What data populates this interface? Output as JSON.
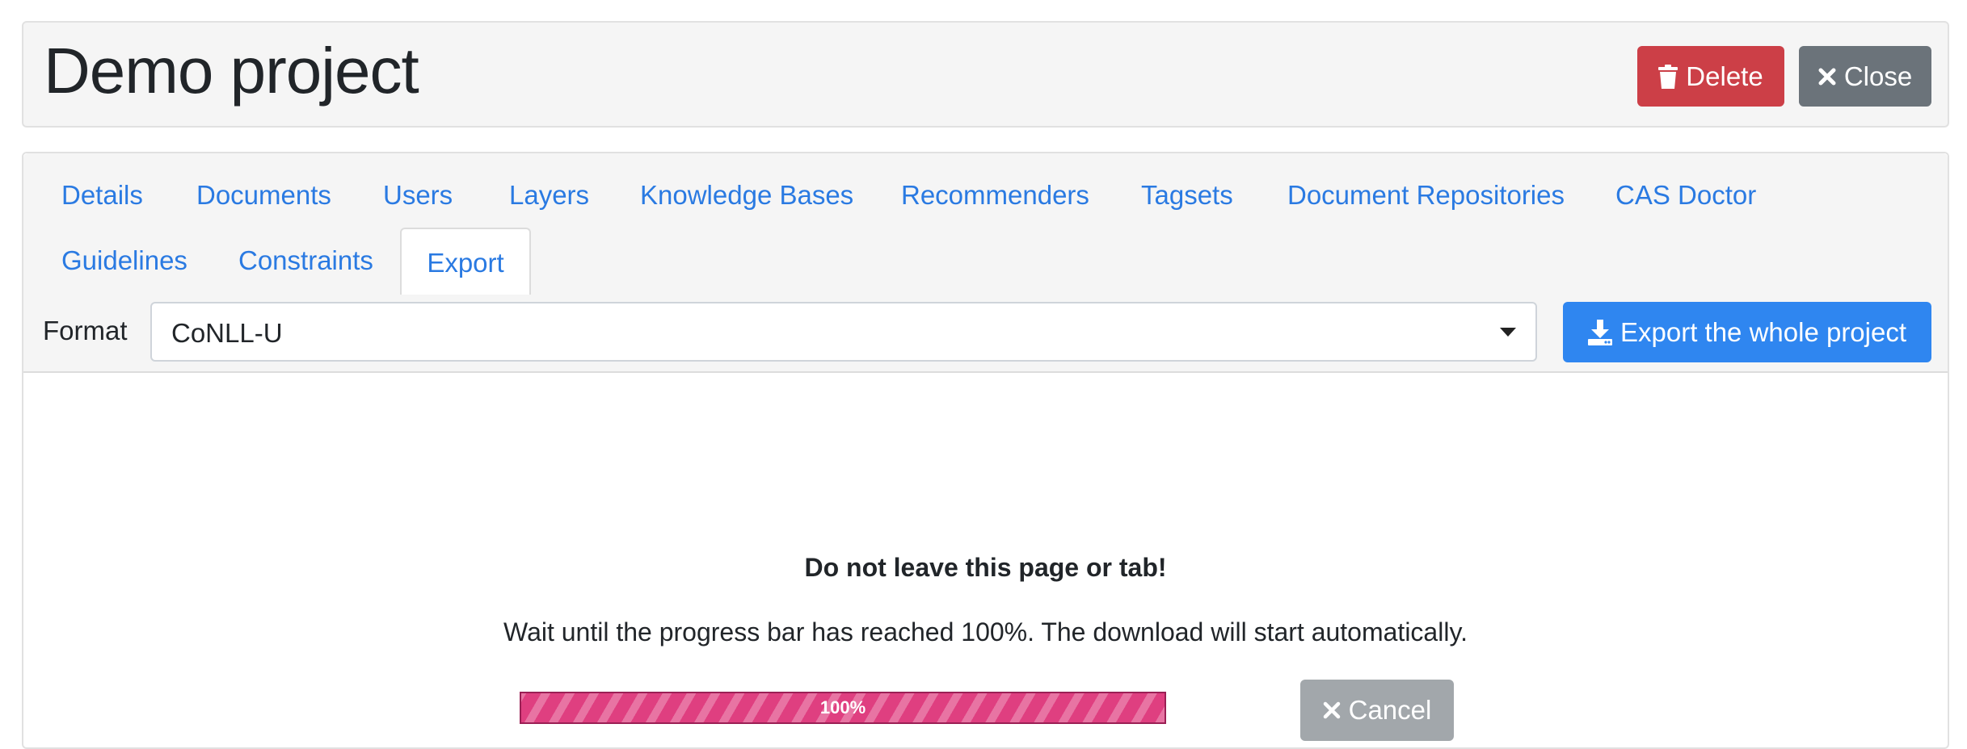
{
  "project": {
    "title": "Demo project",
    "delete_label": "Delete",
    "close_label": "Close"
  },
  "tabs": [
    {
      "label": "Details"
    },
    {
      "label": "Documents"
    },
    {
      "label": "Users"
    },
    {
      "label": "Layers"
    },
    {
      "label": "Knowledge Bases"
    },
    {
      "label": "Recommenders"
    },
    {
      "label": "Tagsets"
    },
    {
      "label": "Document Repositories"
    },
    {
      "label": "CAS Doctor"
    },
    {
      "label": "Guidelines"
    },
    {
      "label": "Constraints"
    },
    {
      "label": "Export",
      "active": true
    }
  ],
  "export": {
    "format_label": "Format",
    "format_value": "CoNLL-U",
    "export_button_label": "Export the whole project",
    "warning_title": "Do not leave this page or tab!",
    "warning_text": "Wait until the progress bar has reached 100%. The download will start automatically.",
    "progress_value": 1.0,
    "progress_label": "100%",
    "cancel_label": "Cancel"
  },
  "icons": {
    "delete": "trash-icon",
    "close": "close-icon",
    "export": "download-icon",
    "select": "chevron-down-icon",
    "cancel": "close-icon"
  },
  "colors": {
    "link": "#2a7ae2",
    "danger": "#cc3f47",
    "secondary": "#6b737a",
    "primary": "#2f86f0",
    "progress": "#df3f80",
    "cancel_disabled": "#a2a7ab"
  }
}
